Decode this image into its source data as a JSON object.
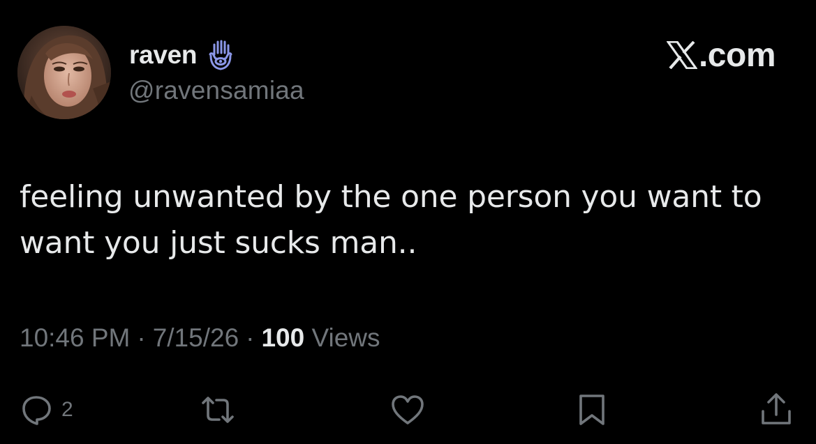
{
  "user": {
    "display_name": "raven",
    "badge_icon": "hamsa-hand-icon",
    "handle": "@ravensamiaa"
  },
  "brand": {
    "icon": "x-logo-icon",
    "text": ".com"
  },
  "tweet": {
    "text": "feeling unwanted by the one person you want to want you just sucks man.."
  },
  "meta": {
    "time": "10:46 PM",
    "separator": "·",
    "date": "7/15/26",
    "views_count": "100",
    "views_label": "Views"
  },
  "actions": {
    "reply_count": "2",
    "icons": [
      "reply-icon",
      "retweet-icon",
      "like-icon",
      "bookmark-icon",
      "share-icon"
    ]
  },
  "colors": {
    "background": "#000000",
    "primary_text": "#e7e9ea",
    "secondary_text": "#71767b",
    "badge": "#8b97e8"
  }
}
